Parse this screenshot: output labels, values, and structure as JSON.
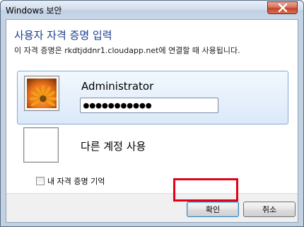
{
  "window": {
    "title": "Windows 보안"
  },
  "dialog": {
    "heading": "사용자 자격 증명 입력",
    "subtext": "이 자격 증명은 rkdtjddnr1.cloudapp.net에 연결할 때 사용됩니다."
  },
  "accounts": {
    "selected": {
      "username": "Administrator",
      "password_value": "●●●●●●●●●●●"
    },
    "other": {
      "label": "다른 계정 사용"
    }
  },
  "remember": {
    "label": "내 자격 증명 기억",
    "checked": false
  },
  "buttons": {
    "ok": "확인",
    "cancel": "취소"
  },
  "colors": {
    "heading": "#1c3e8f",
    "highlight": "#e3001b",
    "close_button": "#c4452a"
  }
}
